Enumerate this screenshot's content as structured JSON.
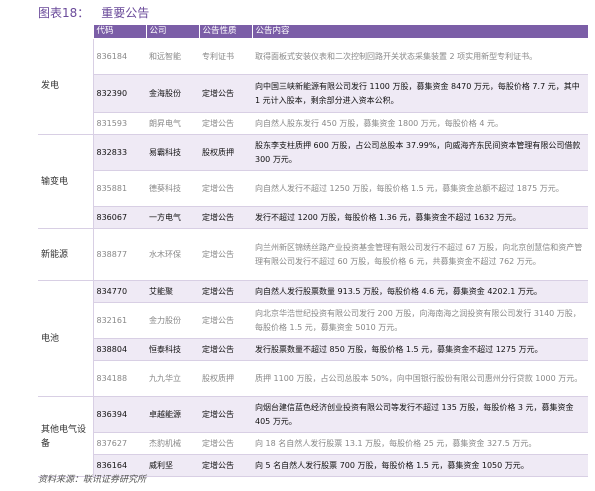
{
  "header": {
    "figure_no": "图表18：",
    "title": "重要公告",
    "columns": [
      "代码",
      "公司",
      "公告性质",
      "公告内容"
    ]
  },
  "rows": [
    {
      "category": "发电",
      "code": "836184",
      "company": "和远智能",
      "type": "专利证书",
      "content": "取得面板式安装仪表和二次控制回路开关状态采集装置 2 项实用新型专利证书。",
      "hl": false
    },
    {
      "category": "",
      "code": "832390",
      "company": "金海股份",
      "type": "定增公告",
      "content": "向中国三峡新能源有限公司发行 1100 万股，募集资金 8470 万元，每股价格 7.7 元，其中 1 元计入股本，剩余部分进入资本公积。",
      "hl": true
    },
    {
      "category": "",
      "code": "831593",
      "company": "朗昇电气",
      "type": "定增公告",
      "content": "向自然人股东发行 450 万股，募集资金 1800 万元，每股价格 4 元。",
      "hl": false
    },
    {
      "category": "输变电",
      "code": "832833",
      "company": "易霸科技",
      "type": "股权质押",
      "content": "股东李支柱质押 600 万股，占公司总股本 37.99%，向威海齐东民间资本管理有限公司借款 300 万元。",
      "hl": true
    },
    {
      "category": "",
      "code": "835881",
      "company": "德葵科技",
      "type": "定增公告",
      "content": "向自然人发行不超过 1250 万股，每股价格 1.5 元，募集资金总额不超过 1875 万元。",
      "hl": false
    },
    {
      "category": "",
      "code": "836067",
      "company": "一方电气",
      "type": "定增公告",
      "content": "发行不超过 1200 万股，每股价格 1.36 元，募集资金不超过 1632 万元。",
      "hl": true
    },
    {
      "category": "新能源",
      "code": "838877",
      "company": "水木环保",
      "type": "定增公告",
      "content": "向兰州新区锦绣丝路产业投资基金管理有限公司发行不超过 67 万股，向北京创慧信和资产管理有限公司发行不超过 60 万股，每股价格 6 元，共募集资金不超过 762 万元。",
      "hl": false
    },
    {
      "category": "电池",
      "code": "834770",
      "company": "艾能聚",
      "type": "定增公告",
      "content": "向自然人发行股票数量 913.5 万股，每股价格 4.6 元，募集资金 4202.1 万元。",
      "hl": true
    },
    {
      "category": "",
      "code": "832161",
      "company": "金力股份",
      "type": "定增公告",
      "content": "向北京华浩世纪投资有限公司发行 200 万股，向海南海之润投资有限公司发行 3140 万股，每股价格 1.5 元，募集资金 5010 万元。",
      "hl": false
    },
    {
      "category": "",
      "code": "838804",
      "company": "恒泰科技",
      "type": "定增公告",
      "content": "发行股票数量不超过 850 万股，每股价格 1.5 元，募集资金不超过 1275 万元。",
      "hl": true
    },
    {
      "category": "",
      "code": "834188",
      "company": "九九华立",
      "type": "股权质押",
      "content": "质押 1100 万股，占公司总股本 50%，向中国银行股份有限公司惠州分行贷款 1000 万元。",
      "hl": false
    },
    {
      "category": "其他电气设备",
      "code": "836394",
      "company": "卓越能源",
      "type": "定增公告",
      "content": "向烟台建信蓝色经济创业投资有限公司等发行不超过 135 万股，每股价格 3 元，募集资金 405 万元。",
      "hl": true
    },
    {
      "category": "",
      "code": "837627",
      "company": "杰豹机械",
      "type": "定增公告",
      "content": "向 18 名自然人发行股票 13.1 万股，每股价格 25 元，募集资金 327.5 万元。",
      "hl": false
    },
    {
      "category": "",
      "code": "836164",
      "company": "威利坚",
      "type": "定增公告",
      "content": "向 5 名自然人发行股票 700 万股，每股价格 1.5 元，募集资金 1050 万元。",
      "hl": true
    }
  ],
  "source": "资料来源：联讯证券研究所"
}
